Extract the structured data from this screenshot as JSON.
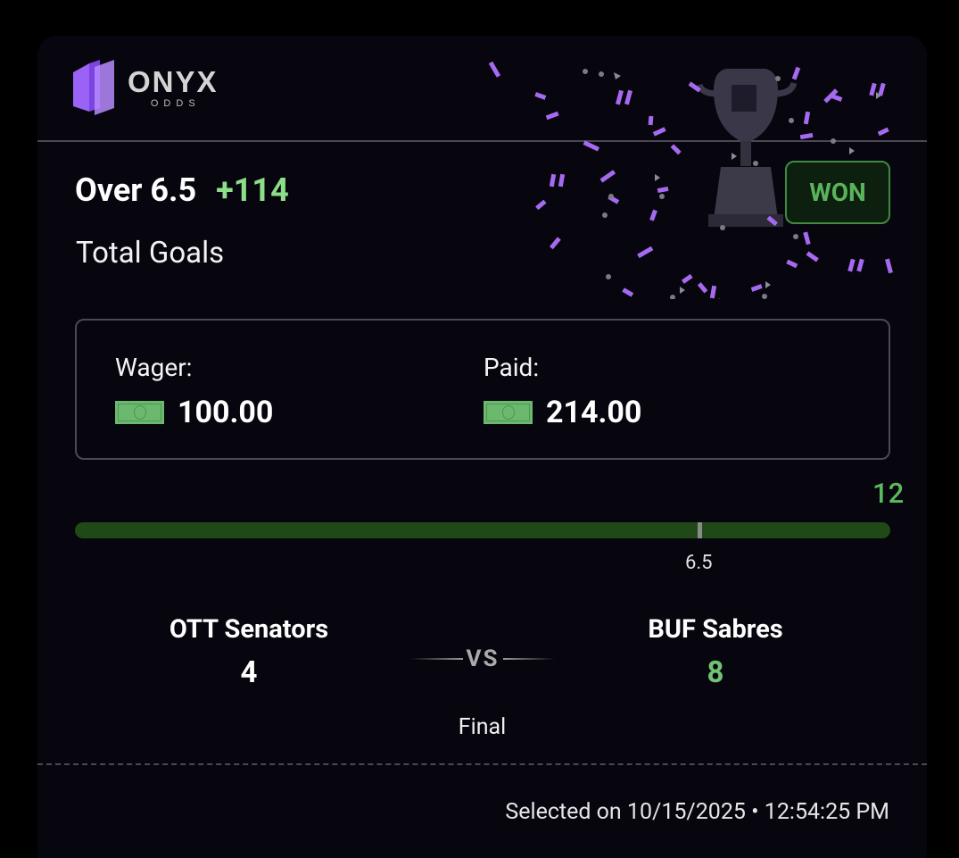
{
  "brand": {
    "name": "ONYX",
    "sub": "ODDS",
    "accent": "#8b5cf6"
  },
  "bet": {
    "selection": "Over 6.5",
    "odds": "+114",
    "market": "Total Goals",
    "status": "WON",
    "wager_label": "Wager:",
    "wager_amount": "100.00",
    "paid_label": "Paid:",
    "paid_amount": "214.00",
    "money_icon": "money-bill-icon"
  },
  "progress": {
    "current_total": "12",
    "line_label": "6.5",
    "line_value": 6.5,
    "current_value": 12,
    "fill_fraction": 1.0
  },
  "game": {
    "home_team": "OTT Senators",
    "home_score": "4",
    "away_team": "BUF Sabres",
    "away_score": "8",
    "vs": "VS",
    "status": "Final"
  },
  "footer": {
    "selected_at": "Selected on 10/15/2025 • 12:54:25 PM"
  },
  "colors": {
    "win_green": "#8ddd8a",
    "track_green": "#1f4a17",
    "confetti_purple": "#a56af0",
    "background": "#07050d"
  },
  "icons": {
    "trophy": "trophy-icon",
    "confetti": "confetti-icon"
  }
}
